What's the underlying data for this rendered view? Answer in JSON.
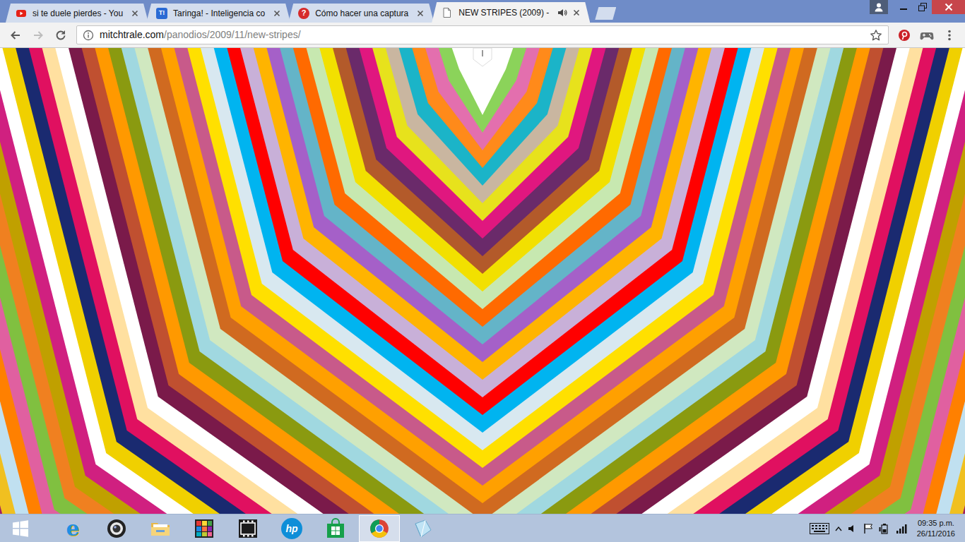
{
  "browser": {
    "tabs": [
      {
        "label": "si te duele pierdes - You",
        "kind": "youtube",
        "audio": false,
        "selected": false
      },
      {
        "label": "Taringa! - Inteligencia co",
        "kind": "taringa",
        "icon_text": "T!",
        "audio": false,
        "selected": false
      },
      {
        "label": "Cómo hacer una captura",
        "kind": "help",
        "icon_text": "?",
        "audio": false,
        "selected": false
      },
      {
        "label": "NEW STRIPES (2009) -",
        "kind": "page",
        "audio": true,
        "selected": true
      }
    ],
    "toolbar": {
      "back_enabled": true,
      "forward_enabled": false,
      "bookmarked": false
    },
    "address": {
      "domain": "mitchtrale.com",
      "path": "/panodios/2009/11/new-stripes/"
    }
  },
  "taskbar": {
    "apps": [
      {
        "kind": "ie",
        "glyph": "e",
        "active": false
      },
      {
        "kind": "webcam",
        "active": false
      },
      {
        "kind": "folder",
        "active": false
      },
      {
        "kind": "paint",
        "active": false
      },
      {
        "kind": "video",
        "active": false
      },
      {
        "kind": "hp",
        "glyph": "hp",
        "active": false
      },
      {
        "kind": "store",
        "active": false
      },
      {
        "kind": "chrome",
        "active": true
      },
      {
        "kind": "notes",
        "active": false
      }
    ],
    "clock": {
      "time": "09:35 p.m.",
      "date": "26/11/2016"
    }
  }
}
